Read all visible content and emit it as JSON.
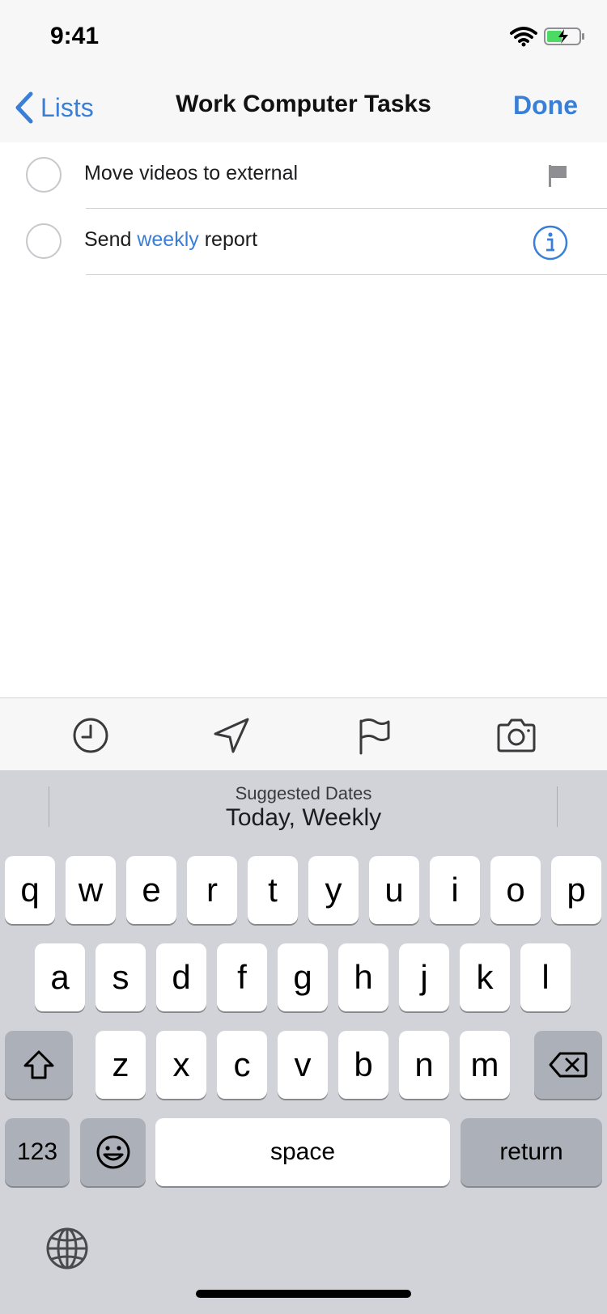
{
  "status_bar": {
    "time": "9:41"
  },
  "nav": {
    "back_label": "Lists",
    "title": "Work Computer Tasks",
    "done_label": "Done"
  },
  "tasks": [
    {
      "text": "Move videos to external",
      "trailing_icon": "flag-icon"
    },
    {
      "text_before": "Send ",
      "text_highlight": "weekly",
      "text_after": " report",
      "trailing_icon": "info-icon"
    }
  ],
  "toolbar": {
    "icons": [
      "clock-icon",
      "location-arrow-icon",
      "flag-icon",
      "camera-icon"
    ]
  },
  "keyboard": {
    "suggestion_caption": "Suggested Dates",
    "suggestion_value": "Today, Weekly",
    "row1": [
      "q",
      "w",
      "e",
      "r",
      "t",
      "y",
      "u",
      "i",
      "o",
      "p"
    ],
    "row2": [
      "a",
      "s",
      "d",
      "f",
      "g",
      "h",
      "j",
      "k",
      "l"
    ],
    "row3": [
      "z",
      "x",
      "c",
      "v",
      "b",
      "n",
      "m"
    ],
    "numbers_label": "123",
    "space_label": "space",
    "return_label": "return"
  },
  "colors": {
    "accent": "#3a7fd7",
    "keyboard_bg": "#d1d3d9",
    "key_dark": "#acb0b9"
  }
}
